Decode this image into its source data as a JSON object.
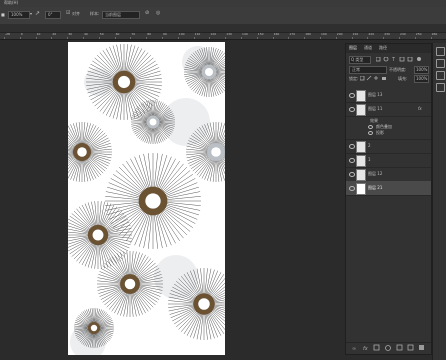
{
  "menubar": {
    "label": "帮助(H)"
  },
  "options": {
    "opacity_label": "■",
    "opacity_value": "100%",
    "flow_value": "0°",
    "sample_label": "样本:",
    "sample_value": "当前图层",
    "lock_label": "■"
  },
  "ruler": {
    "marks": [
      "-28",
      "0",
      "10",
      "20",
      "30",
      "40",
      "50",
      "60",
      "70",
      "80",
      "90",
      "100",
      "110",
      "120",
      "130",
      "140",
      "150",
      "160",
      "170",
      "180",
      "190",
      "200",
      "210",
      "220",
      "230",
      "240",
      "250",
      "260"
    ]
  },
  "panel": {
    "tabs": [
      "图层",
      "通道",
      "路径"
    ],
    "kind_label": "Q 类型",
    "blend_mode": "正常",
    "opacity_label": "不透明度:",
    "opacity_value": "100%",
    "lock_label": "锁定:",
    "fill_label": "填充:",
    "fill_value": "100%",
    "layers": [
      {
        "name": "图层 13"
      },
      {
        "name": "图层 11",
        "fx": "fx"
      },
      {
        "name": "2"
      },
      {
        "name": "1"
      },
      {
        "name": "图层 12"
      },
      {
        "name": "图层 21"
      }
    ],
    "effects": {
      "title": "效果",
      "items": [
        "颜色叠加",
        "投影"
      ]
    }
  },
  "colors": {
    "brown": "#6b5233",
    "gray": "#b9bfc4",
    "light_gray": "#eceef0"
  }
}
